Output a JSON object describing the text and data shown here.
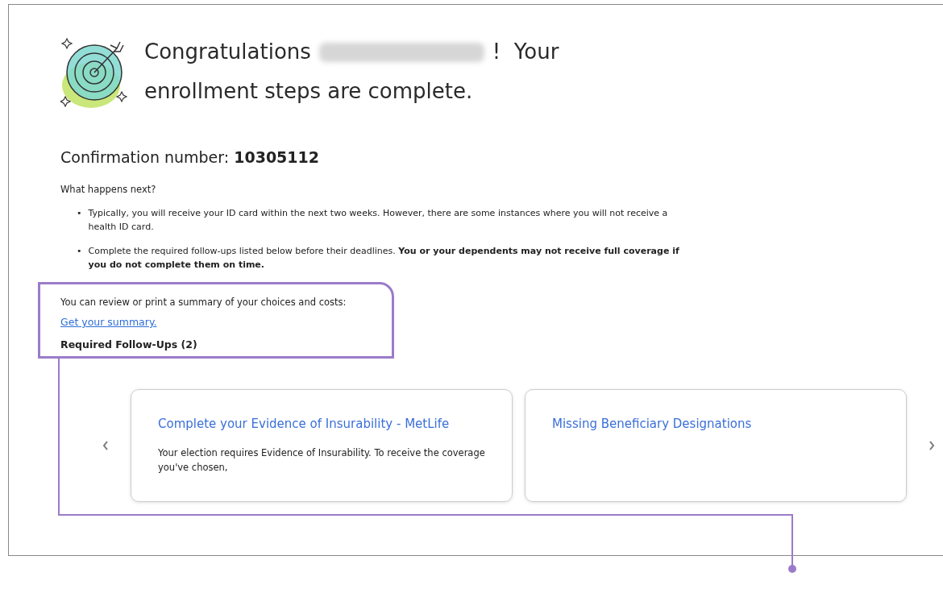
{
  "heading": {
    "before_name": "Congratulations",
    "after_name": "!  Your",
    "line_2": "enrollment steps are complete."
  },
  "confirmation": {
    "label": "Confirmation number:",
    "value": "10305112"
  },
  "next_steps": {
    "title": "What happens next?",
    "marker": "•",
    "bullets": [
      "Typically, you will receive your ID card within the next two weeks. However, there are some instances where you will not receive a health ID card.",
      "Complete the required follow-ups listed below before their deadlines. **You or your dependents may not receive full coverage if you do not complete them on time.**"
    ]
  },
  "summary": {
    "text": "You can review or print a summary of your choices and costs:",
    "link": "Get your summary."
  },
  "follow_ups": {
    "title": "Required Follow-Ups (2)",
    "cards": [
      {
        "title": "Complete your Evidence of Insurability - MetLife",
        "text": "Your election requires Evidence of Insurability. To receive the coverage you've chosen,"
      },
      {
        "title": "Missing Beneficiary Designations"
      }
    ]
  }
}
